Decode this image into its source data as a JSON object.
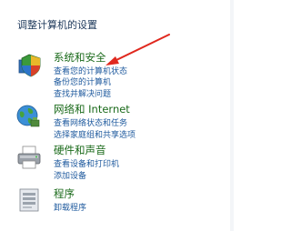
{
  "heading": "调整计算机的设置",
  "categories": [
    {
      "icon": "shield-icon",
      "title": "系统和安全",
      "links": [
        "查看您的计算机状态",
        "备份您的计算机",
        "查找并解决问题"
      ]
    },
    {
      "icon": "network-globe-icon",
      "title": "网络和 Internet",
      "links": [
        "查看网络状态和任务",
        "选择家庭组和共享选项"
      ]
    },
    {
      "icon": "printer-icon",
      "title": "硬件和声音",
      "links": [
        "查看设备和打印机",
        "添加设备"
      ]
    },
    {
      "icon": "programs-icon",
      "title": "程序",
      "links": [
        "卸载程序"
      ]
    }
  ],
  "colors": {
    "category_title": "#1a6a1a",
    "link": "#1f5a9e",
    "heading": "#1e395b",
    "annotation_arrow": "#e0281e"
  }
}
